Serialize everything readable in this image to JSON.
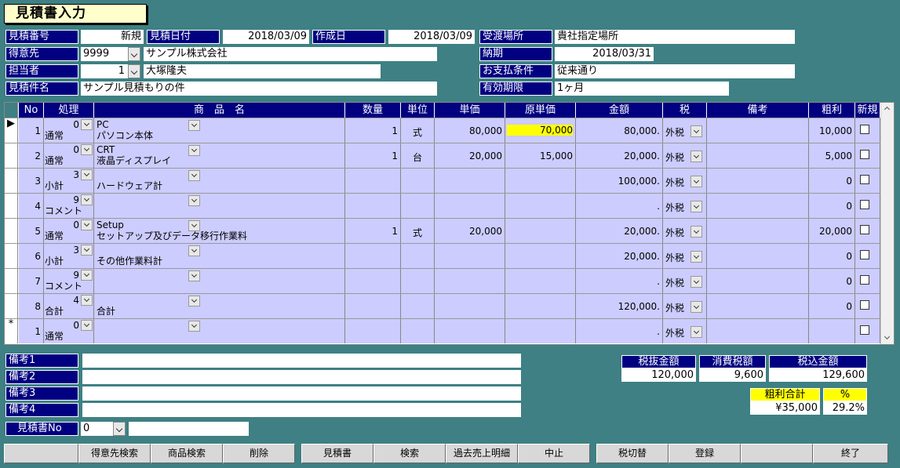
{
  "title": "見積書入力",
  "header": {
    "est_no_label": "見積番号",
    "est_no_value": "新規",
    "est_date_label": "見積日付",
    "est_date_value": "2018/03/09",
    "created_label": "作成日",
    "created_value": "2018/03/09",
    "delivery_place_label": "受渡場所",
    "delivery_place_value": "貴社指定場所",
    "customer_label": "得意先",
    "customer_code": "9999",
    "customer_name": "サンプル株式会社",
    "due_label": "納期",
    "due_value": "2018/03/31",
    "staff_label": "担当者",
    "staff_code": "1",
    "staff_name": "大塚隆夫",
    "payment_label": "お支払条件",
    "payment_value": "従来通り",
    "subject_label": "見積件名",
    "subject_value": "サンプル見積もりの件",
    "validity_label": "有効期限",
    "validity_value": "1ヶ月"
  },
  "grid": {
    "columns": [
      "No",
      "処理",
      "商　品　名",
      "数量",
      "単位",
      "単価",
      "原単価",
      "金額",
      "税",
      "備考",
      "粗利",
      "新規"
    ],
    "rows": [
      {
        "sel": "▶",
        "no": "1",
        "code": "0",
        "kind": "通常",
        "pcode": "PC",
        "pname": "パソコン本体",
        "qty": "1",
        "unit": "式",
        "price": "80,000",
        "cost": "70,000",
        "amount": "80,000.",
        "tax": "外税",
        "note": "",
        "profit": "10,000"
      },
      {
        "sel": "",
        "no": "2",
        "code": "0",
        "kind": "通常",
        "pcode": "CRT",
        "pname": "液晶ディスプレイ",
        "qty": "1",
        "unit": "台",
        "price": "20,000",
        "cost": "15,000",
        "amount": "20,000.",
        "tax": "外税",
        "note": "",
        "profit": "5,000"
      },
      {
        "sel": "",
        "no": "3",
        "code": "3",
        "kind": "小計",
        "pcode": "",
        "pname": "ハードウェア計",
        "qty": "",
        "unit": "",
        "price": "",
        "cost": "",
        "amount": "100,000.",
        "tax": "外税",
        "note": "",
        "profit": "0"
      },
      {
        "sel": "",
        "no": "4",
        "code": "9",
        "kind": "コメント",
        "pcode": "",
        "pname": "",
        "qty": "",
        "unit": "",
        "price": "",
        "cost": "",
        "amount": ".",
        "tax": "外税",
        "note": "",
        "profit": "0"
      },
      {
        "sel": "",
        "no": "5",
        "code": "0",
        "kind": "通常",
        "pcode": "Setup",
        "pname": "セットアップ及びデータ移行作業料",
        "qty": "1",
        "unit": "式",
        "price": "20,000",
        "cost": "",
        "amount": "20,000.",
        "tax": "外税",
        "note": "",
        "profit": "20,000"
      },
      {
        "sel": "",
        "no": "6",
        "code": "3",
        "kind": "小計",
        "pcode": "",
        "pname": "その他作業料計",
        "qty": "",
        "unit": "",
        "price": "",
        "cost": "",
        "amount": "20,000.",
        "tax": "外税",
        "note": "",
        "profit": "0"
      },
      {
        "sel": "",
        "no": "7",
        "code": "9",
        "kind": "コメント",
        "pcode": "",
        "pname": "",
        "qty": "",
        "unit": "",
        "price": "",
        "cost": "",
        "amount": ".",
        "tax": "外税",
        "note": "",
        "profit": "0"
      },
      {
        "sel": "",
        "no": "8",
        "code": "4",
        "kind": "合計",
        "pcode": "",
        "pname": "合計",
        "qty": "",
        "unit": "",
        "price": "",
        "cost": "",
        "amount": "120,000.",
        "tax": "外税",
        "note": "",
        "profit": "0"
      },
      {
        "sel": "*",
        "no": "1",
        "code": "0",
        "kind": "通常",
        "pcode": "",
        "pname": "",
        "qty": "",
        "unit": "",
        "price": "",
        "cost": "",
        "amount": ".",
        "tax": "外税",
        "note": "",
        "profit": ""
      }
    ]
  },
  "notes": {
    "note1_label": "備考1",
    "note2_label": "備考2",
    "note3_label": "備考3",
    "note4_label": "備考4",
    "est_doc_label": "見積書No",
    "est_doc_code": "0"
  },
  "totals": {
    "pretax_label": "税抜金額",
    "pretax_value": "120,000",
    "tax_label": "消費税額",
    "tax_value": "9,600",
    "total_label": "税込金額",
    "total_value": "129,600",
    "profit_label": "粗利合計",
    "profit_value": "¥35,000",
    "pct_label": "%",
    "pct_value": "29.2%"
  },
  "buttons": [
    "",
    "得意先検索",
    "商品検索",
    "削除",
    "見積書",
    "検索",
    "過去売上明細",
    "中止",
    "税切替",
    "登録",
    "",
    "終了"
  ]
}
